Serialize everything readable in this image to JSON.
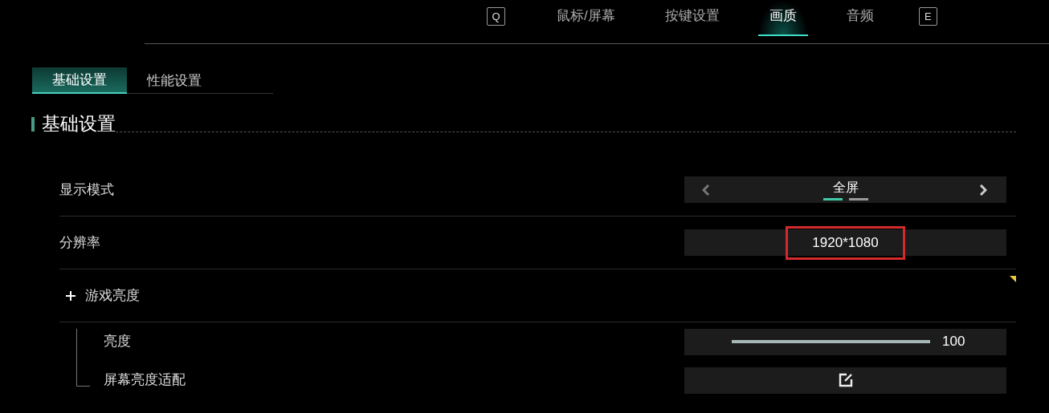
{
  "top_tabs": [
    {
      "kind": "key",
      "label": "Q"
    },
    {
      "kind": "tab",
      "label": "鼠标/屏幕",
      "selected": false
    },
    {
      "kind": "tab",
      "label": "按键设置",
      "selected": false
    },
    {
      "kind": "tab",
      "label": "画质",
      "selected": true
    },
    {
      "kind": "tab",
      "label": "音频",
      "selected": false
    },
    {
      "kind": "key",
      "label": "E"
    }
  ],
  "sub_tabs": [
    {
      "label": "基础设置",
      "selected": true
    },
    {
      "label": "性能设置",
      "selected": false
    }
  ],
  "section": {
    "title": "基础设置"
  },
  "rows": [
    {
      "kind": "selector",
      "label": "显示模式",
      "value": "全屏",
      "pages": [
        {
          "selected": true
        },
        {
          "selected": false
        }
      ]
    },
    {
      "kind": "value",
      "label": "分辨率",
      "value": "1920*1080",
      "highlighted": true
    },
    {
      "kind": "group",
      "label": "游戏亮度",
      "expanded": true,
      "children": [
        {
          "kind": "slider",
          "label": "亮度",
          "level": 1,
          "reading": "100"
        },
        {
          "kind": "edit",
          "label": "屏幕亮度适配"
        }
      ]
    }
  ]
}
